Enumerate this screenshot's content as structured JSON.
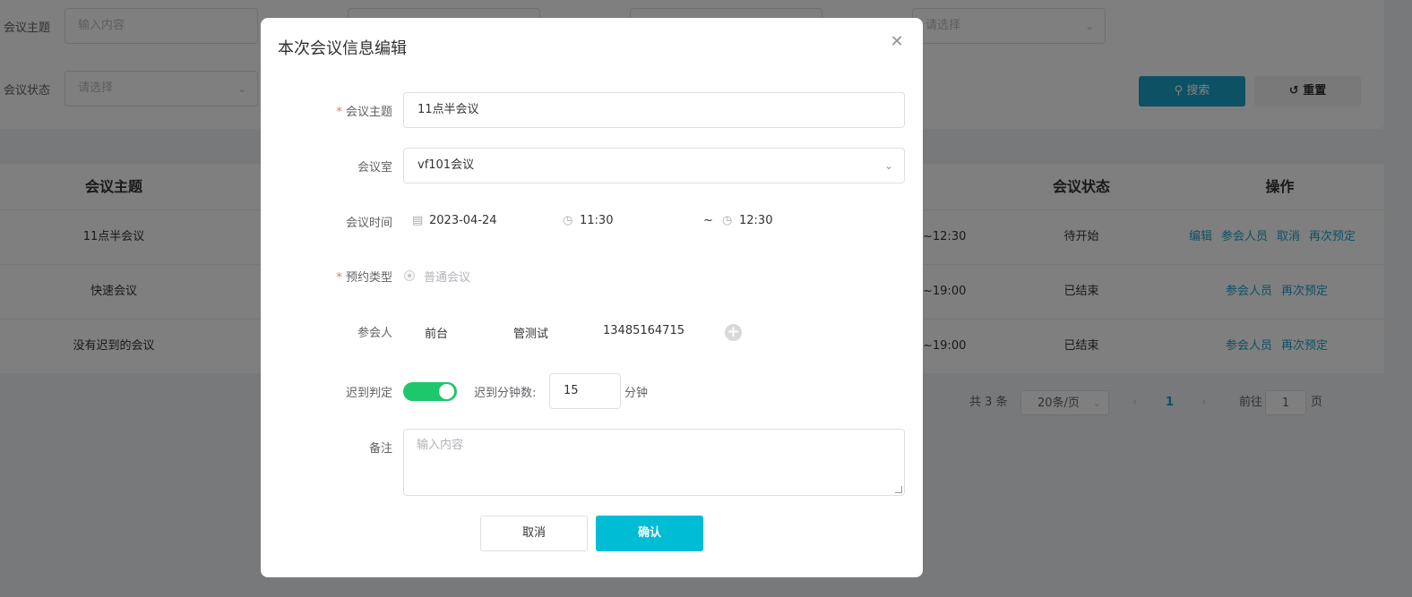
{
  "filters": {
    "subject_label": "会议主题",
    "subject_placeholder": "输入内容",
    "select_placeholder": "请选择",
    "status_label": "会议状态",
    "status_placeholder": "请选择",
    "search_label": "搜索",
    "reset_label": "重置"
  },
  "table": {
    "headers": {
      "subject": "会议主题",
      "status": "会议状态",
      "ops": "操作"
    },
    "rows": [
      {
        "subject": "11点半会议",
        "time_tail": "~12:30",
        "status": "待开始",
        "ops": [
          "编辑",
          "参会人员",
          "取消",
          "再次预定"
        ]
      },
      {
        "subject": "快速会议",
        "time_tail": "~19:00",
        "status": "已结束",
        "ops": [
          "参会人员",
          "再次预定"
        ]
      },
      {
        "subject": "没有迟到的会议",
        "time_tail": "~19:00",
        "status": "已结束",
        "ops": [
          "参会人员",
          "再次预定"
        ]
      }
    ]
  },
  "pagination": {
    "total": "共 3 条",
    "page_size": "20条/页",
    "current_page": "1",
    "goto_label": "前往",
    "goto_value": "1",
    "page_suffix": "页"
  },
  "dialog": {
    "title": "本次会议信息编辑",
    "close_icon": "close-icon",
    "fields": {
      "subject_label": "会议主题",
      "subject_value": "11点半会议",
      "room_label": "会议室",
      "room_value": "vf101会议",
      "time_label": "会议时间",
      "date_value": "2023-04-24",
      "start_time": "11:30",
      "range_sep": "~",
      "end_time": "12:30",
      "booking_type_label": "预约类型",
      "booking_type_option": "普通会议",
      "participants_label": "参会人",
      "participants": [
        "前台",
        "管测试",
        "13485164715"
      ],
      "late_check_label": "迟到判定",
      "late_check_on": true,
      "late_minutes_label": "迟到分钟数:",
      "late_minutes_value": "15",
      "late_minutes_unit": "分钟",
      "remark_label": "备注",
      "remark_placeholder": "输入内容"
    },
    "buttons": {
      "cancel": "取消",
      "confirm": "确认"
    }
  },
  "colors": {
    "primary": "#1aa3c8",
    "confirm": "#00bcd4",
    "switch_on": "#1ec66c",
    "required": "#f56c6c"
  }
}
